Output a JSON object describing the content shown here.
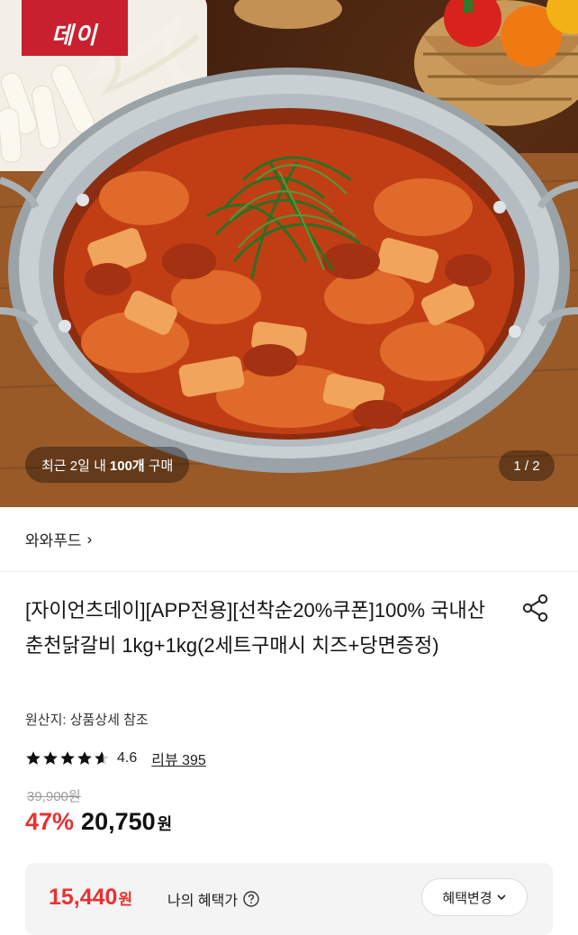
{
  "hero": {
    "brand_logo_text": "데이",
    "recent_purchase": {
      "prefix": "최근 2일 내",
      "count": "100개",
      "suffix": "구매"
    },
    "page_indicator": "1 / 2"
  },
  "seller": {
    "name": "와와푸드",
    "chevron": "›"
  },
  "product": {
    "title": "[자이언츠데이][APP전용][선착순20%쿠폰]100% 국내산 춘천닭갈비 1kg+1kg(2세트구매시 치즈+당면증정)",
    "origin": "원산지: 상품상세 참조",
    "rating": "4.6",
    "rating_stars": 4.6,
    "review": "리뷰 395",
    "original_price": "39,900원",
    "discount": "47%",
    "sale_price": "20,750",
    "currency": "원"
  },
  "benefit": {
    "price": "15,440",
    "unit": "원",
    "label": "나의 혜택가",
    "button": "혜택변경"
  },
  "colors": {
    "accent_red": "#e8322f",
    "benefit_bg": "#f4f4f4",
    "logo_red": "#c8202f"
  },
  "icons": [
    "share-icon",
    "star-icon",
    "help-circle-icon",
    "chevron-down-icon",
    "chevron-right-icon"
  ]
}
